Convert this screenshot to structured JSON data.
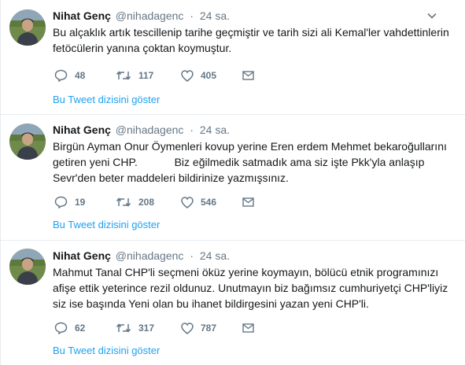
{
  "tweets": [
    {
      "name": "Nihat Genç",
      "handle": "@nihadagenc",
      "separator": "·",
      "time": "24 sa.",
      "text": "Bu alçaklık artık tescillenip tarihe geçmiştir ve tarih sizi ali Kemal'ler vahdettinlerin\nfetöcülerin yanına çoktan koymuştur.",
      "replies": "48",
      "retweets": "117",
      "likes": "405",
      "thread_link": "Bu Tweet dizisini göster"
    },
    {
      "name": "Nihat Genç",
      "handle": "@nihadagenc",
      "separator": "·",
      "time": "24 sa.",
      "text": "Birgün Ayman Onur Öymenleri kovup yerine Eren erdem Mehmet bekaroğullarını\ngetiren yeni CHP.            Biz eğilmedik satmadık ama siz işte Pkk'yla anlaşıp\nSevr'den beter maddeleri bildirinize yazmışsınız.",
      "replies": "19",
      "retweets": "208",
      "likes": "546",
      "thread_link": "Bu Tweet dizisini göster"
    },
    {
      "name": "Nihat Genç",
      "handle": "@nihadagenc",
      "separator": "·",
      "time": "24 sa.",
      "text": "Mahmut Tanal CHP'li seçmeni öküz yerine koymayın, bölücü etnik programınızı\nafişe ettik yeterince rezil oldunuz. Unutmayın biz bağımsız cumhuriyetçi CHP'liyiz\nsiz ise başında Yeni olan bu ihanet bildirgesini yazan yeni CHP'li.",
      "replies": "62",
      "retweets": "317",
      "likes": "787",
      "thread_link": "Bu Tweet dizisini göster"
    }
  ],
  "icons": {
    "reply": "reply-icon",
    "retweet": "retweet-icon",
    "like": "heart-icon",
    "message": "envelope-icon",
    "more": "chevron-down-icon"
  },
  "colors": {
    "link": "#1da1f2",
    "muted": "#657786",
    "text": "#14171a",
    "divider": "#e6ecf0"
  }
}
